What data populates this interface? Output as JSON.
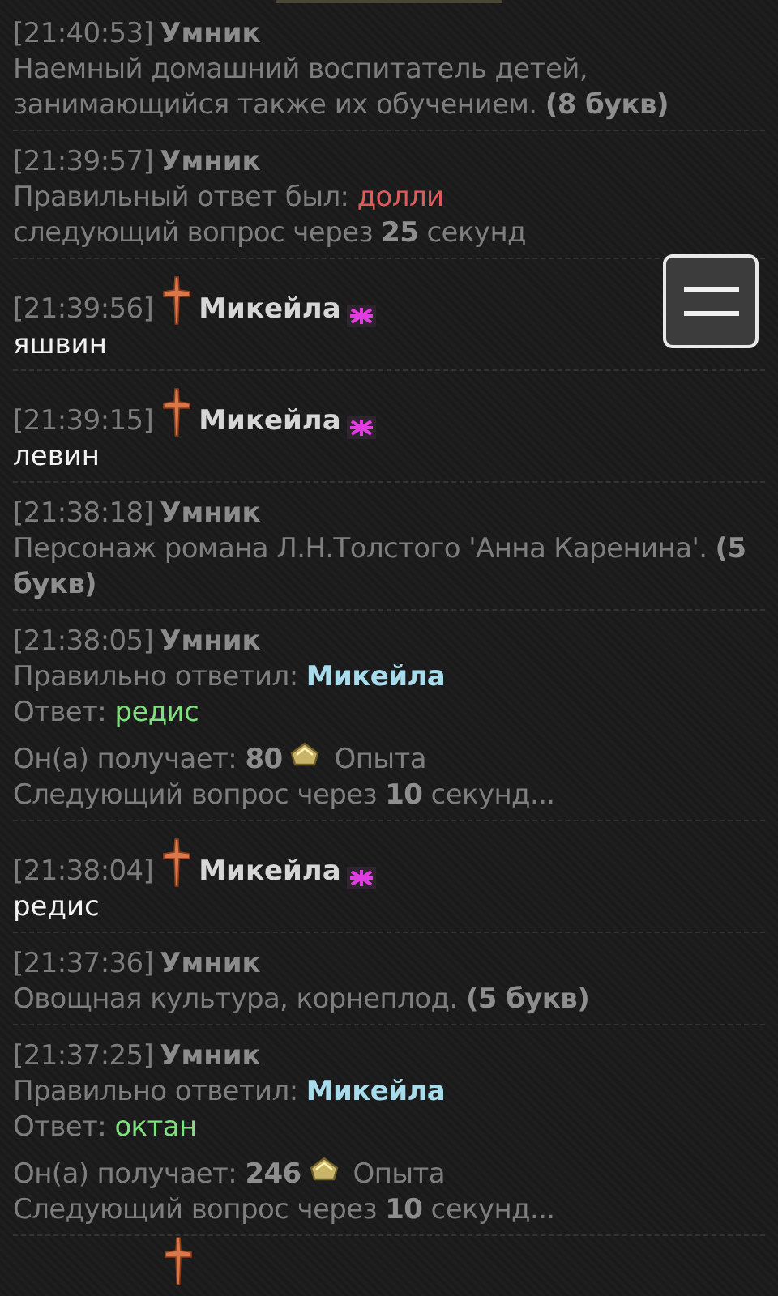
{
  "messages": [
    {
      "kind": "bot",
      "time": "[21:40:53]",
      "author": "Умник",
      "blocks": [
        [
          [
            {
              "kind": "plain",
              "text": "Наемный домашний воспитатель детей, занимающийся также их обучением. "
            },
            {
              "kind": "bold",
              "text": "(8 букв)"
            }
          ]
        ]
      ]
    },
    {
      "kind": "bot",
      "time": "[21:39:57]",
      "author": "Умник",
      "blocks": [
        [
          [
            {
              "kind": "plain",
              "text": "Правильный ответ был: "
            },
            {
              "kind": "wrong",
              "text": "долли"
            }
          ],
          [
            {
              "kind": "plain",
              "text": "следующий вопрос через "
            },
            {
              "kind": "bold",
              "text": "25"
            },
            {
              "kind": "plain",
              "text": " секунд"
            }
          ]
        ]
      ]
    },
    {
      "kind": "user",
      "time": "[21:39:56]",
      "author": "Микейла",
      "text": "яшвин"
    },
    {
      "kind": "user",
      "time": "[21:39:15]",
      "author": "Микейла",
      "text": "левин"
    },
    {
      "kind": "bot",
      "time": "[21:38:18]",
      "author": "Умник",
      "blocks": [
        [
          [
            {
              "kind": "plain",
              "text": "Персонаж романа Л.Н.Толстого 'Анна Каренина'. "
            },
            {
              "kind": "bold",
              "text": "(5 букв)"
            }
          ]
        ]
      ]
    },
    {
      "kind": "bot",
      "time": "[21:38:05]",
      "author": "Умник",
      "blocks": [
        [
          [
            {
              "kind": "plain",
              "text": "Правильно ответил: "
            },
            {
              "kind": "winner",
              "text": "Микейла"
            }
          ],
          [
            {
              "kind": "plain",
              "text": "Ответ: "
            },
            {
              "kind": "right",
              "text": "редис"
            }
          ]
        ],
        [
          [
            {
              "kind": "plain",
              "text": "Он(а) получает: "
            },
            {
              "kind": "bold",
              "text": "80"
            },
            {
              "kind": "coin"
            },
            {
              "kind": "plain",
              "text": "Опыта"
            }
          ],
          [
            {
              "kind": "plain",
              "text": "Следующий вопрос через "
            },
            {
              "kind": "bold",
              "text": "10"
            },
            {
              "kind": "plain",
              "text": " секунд..."
            }
          ]
        ]
      ]
    },
    {
      "kind": "user",
      "time": "[21:38:04]",
      "author": "Микейла",
      "text": "редис"
    },
    {
      "kind": "bot",
      "time": "[21:37:36]",
      "author": "Умник",
      "blocks": [
        [
          [
            {
              "kind": "plain",
              "text": "Овощная культура, корнеплод. "
            },
            {
              "kind": "bold",
              "text": "(5 букв)"
            }
          ]
        ]
      ]
    },
    {
      "kind": "bot",
      "time": "[21:37:25]",
      "author": "Умник",
      "blocks": [
        [
          [
            {
              "kind": "plain",
              "text": "Правильно ответил: "
            },
            {
              "kind": "winner",
              "text": "Микейла"
            }
          ],
          [
            {
              "kind": "plain",
              "text": "Ответ: "
            },
            {
              "kind": "right",
              "text": "октан"
            }
          ]
        ],
        [
          [
            {
              "kind": "plain",
              "text": "Он(а) получает: "
            },
            {
              "kind": "bold",
              "text": "246"
            },
            {
              "kind": "coin"
            },
            {
              "kind": "plain",
              "text": "Опыта"
            }
          ],
          [
            {
              "kind": "plain",
              "text": "Следующий вопрос через "
            },
            {
              "kind": "bold",
              "text": "10"
            },
            {
              "kind": "plain",
              "text": " секунд..."
            }
          ]
        ]
      ]
    },
    {
      "kind": "cut"
    }
  ]
}
